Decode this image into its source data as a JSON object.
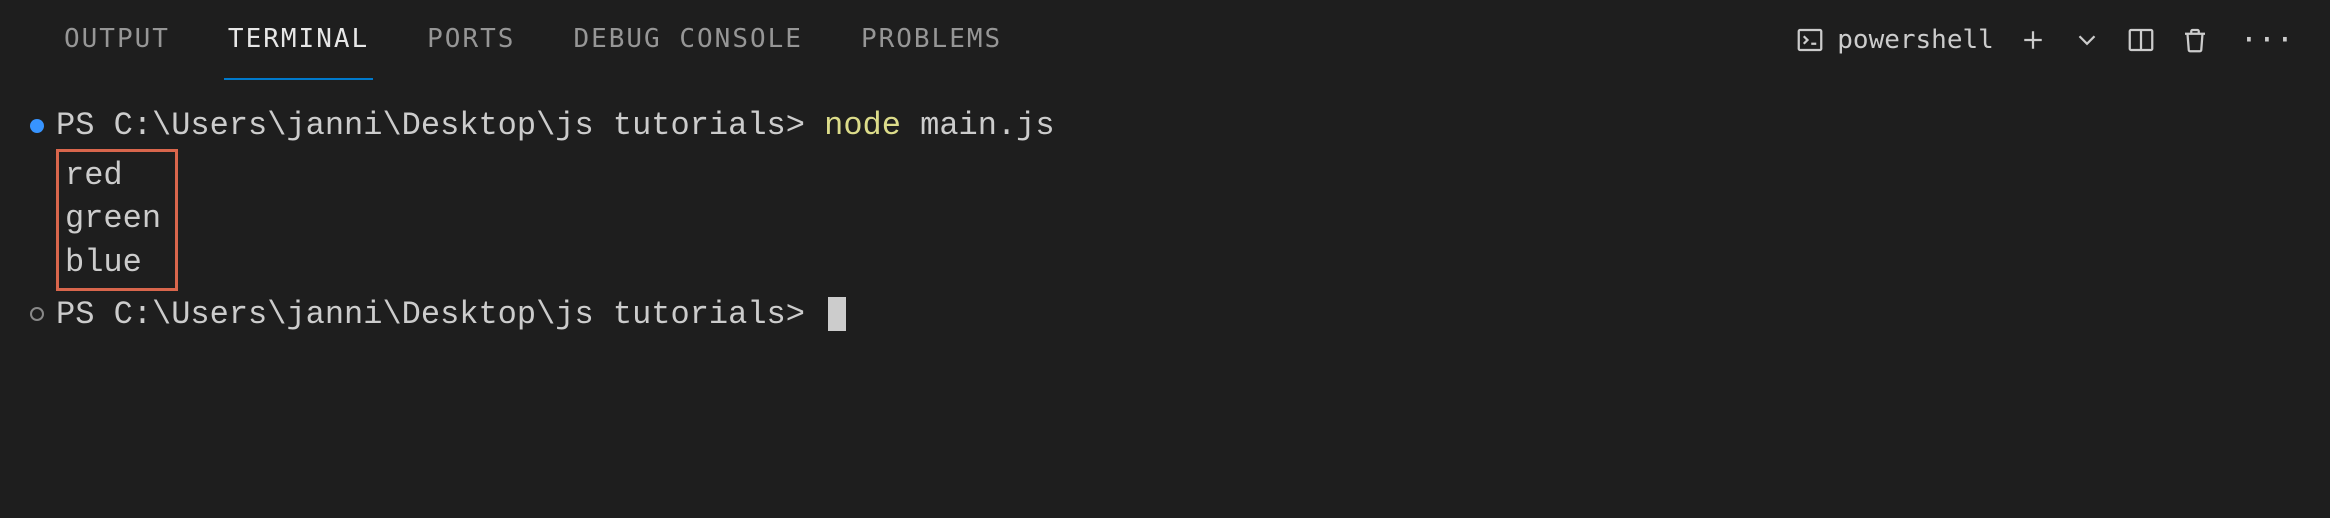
{
  "tabs": {
    "output": "OUTPUT",
    "terminal": "TERMINAL",
    "ports": "PORTS",
    "debug_console": "DEBUG CONSOLE",
    "problems": "PROBLEMS"
  },
  "toolbar": {
    "shell_label": "powershell"
  },
  "terminal": {
    "prompt1_prefix": "PS ",
    "prompt1_path": "C:\\Users\\janni\\Desktop\\js tutorials> ",
    "cmd_keyword": "node",
    "cmd_arg": " main.js",
    "output": [
      "red",
      "green",
      "blue"
    ],
    "prompt2_prefix": "PS ",
    "prompt2_path": "C:\\Users\\janni\\Desktop\\js tutorials> "
  }
}
